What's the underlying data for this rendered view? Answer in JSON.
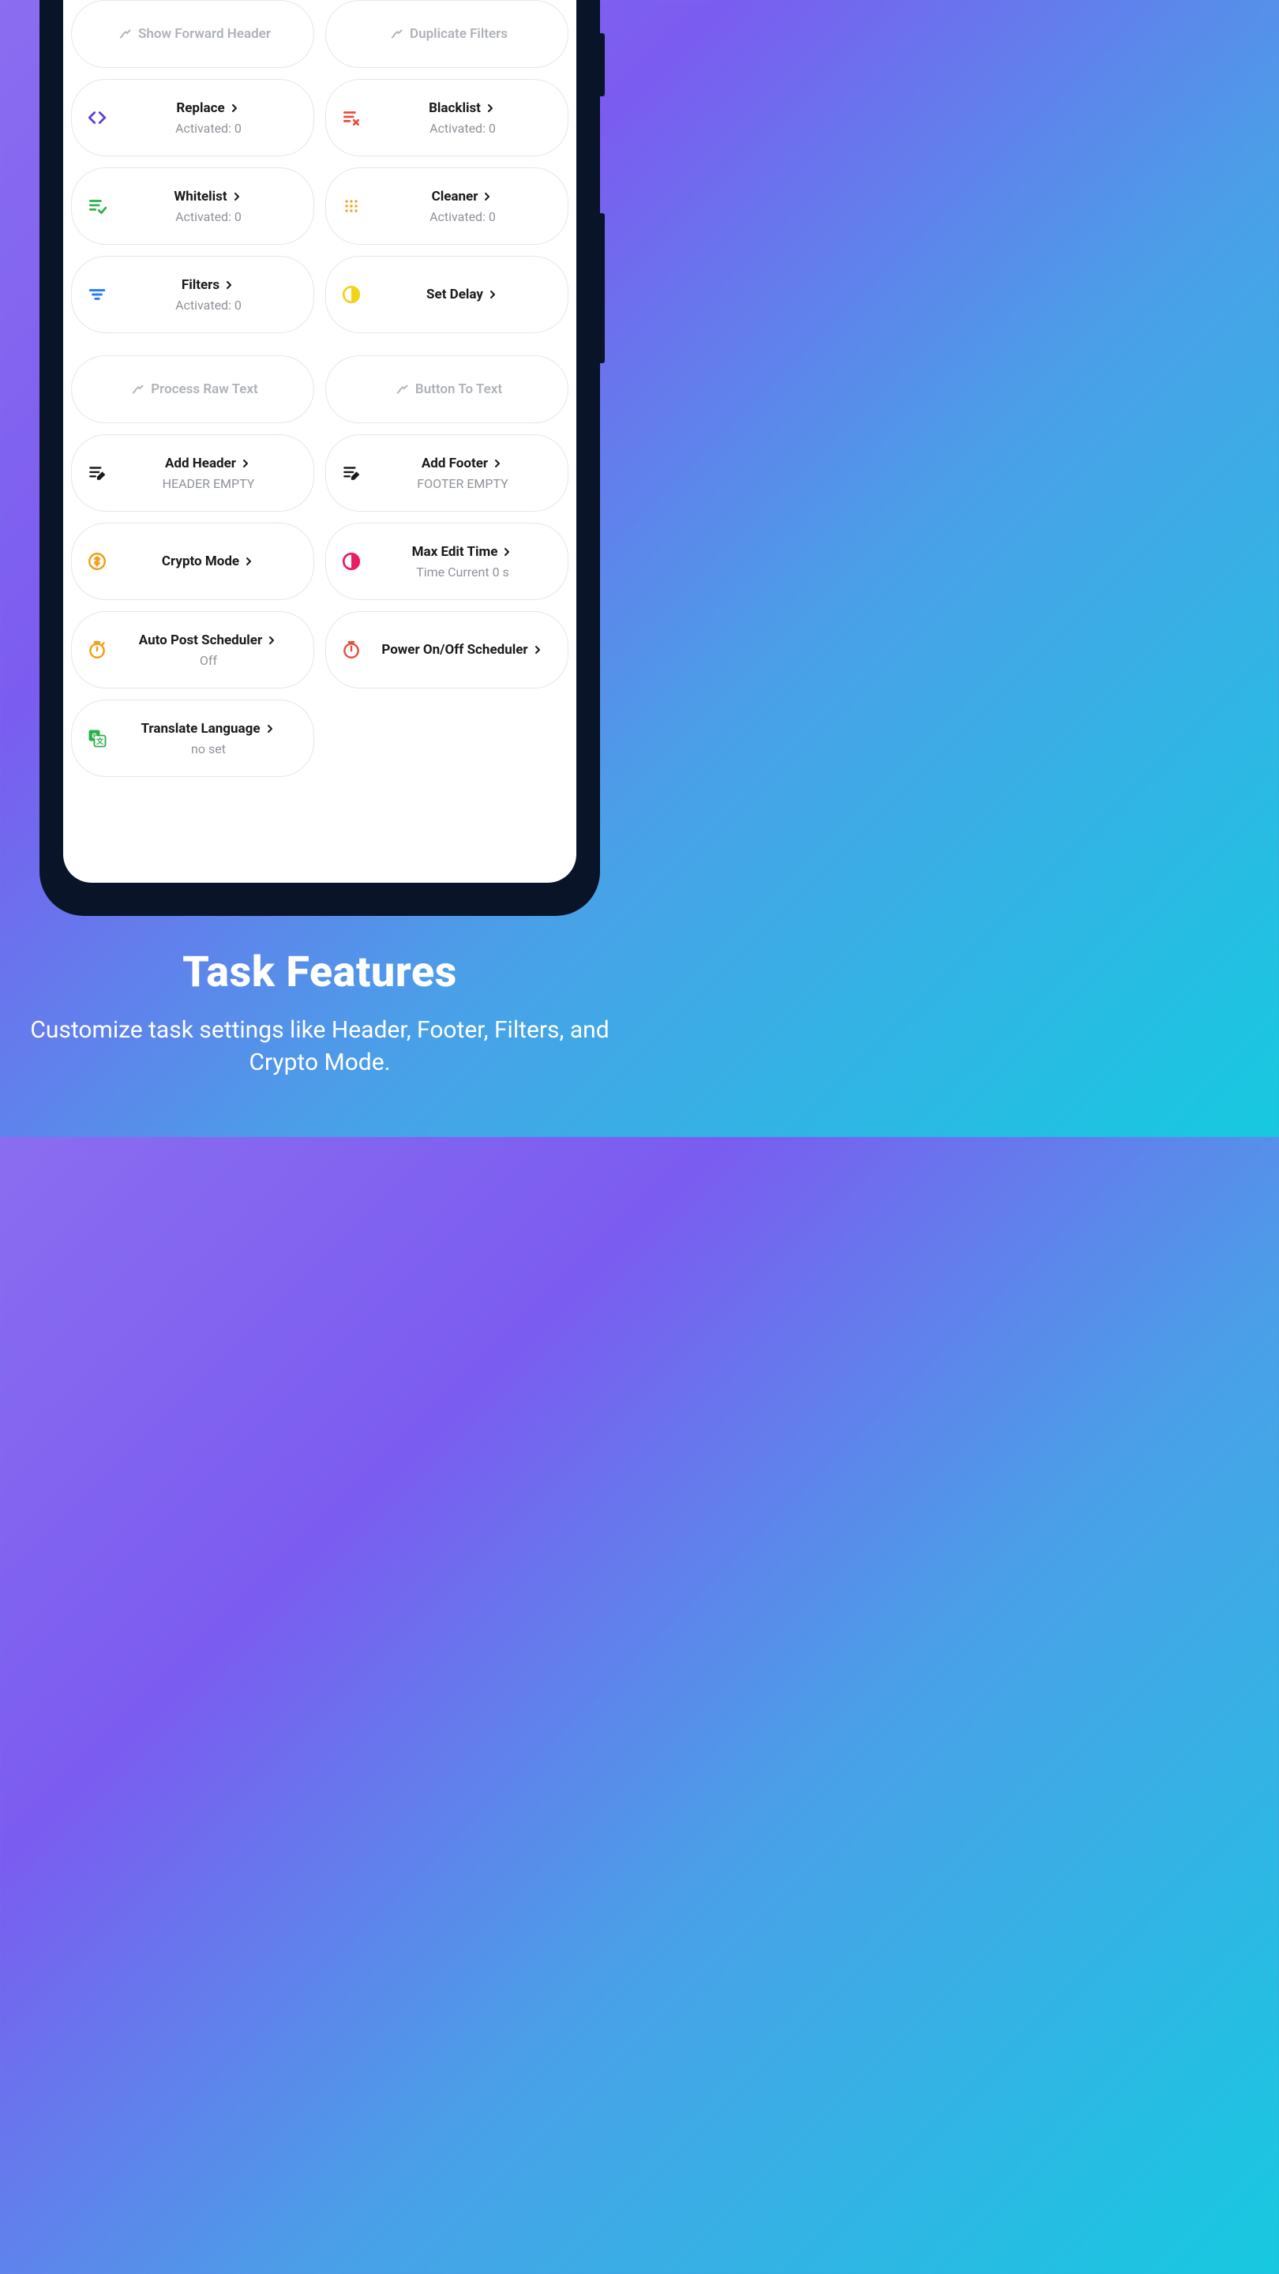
{
  "cards": {
    "show_forward_header": {
      "label": "Show Forward Header"
    },
    "duplicate_filters": {
      "label": "Duplicate Filters"
    },
    "replace": {
      "label": "Replace",
      "sub": "Activated: 0"
    },
    "blacklist": {
      "label": "Blacklist",
      "sub": "Activated: 0"
    },
    "whitelist": {
      "label": "Whitelist",
      "sub": "Activated: 0"
    },
    "cleaner": {
      "label": "Cleaner",
      "sub": "Activated: 0"
    },
    "filters": {
      "label": "Filters",
      "sub": "Activated: 0"
    },
    "set_delay": {
      "label": "Set Delay"
    },
    "process_raw_text": {
      "label": "Process Raw Text"
    },
    "button_to_text": {
      "label": "Button To Text"
    },
    "add_header": {
      "label": "Add Header",
      "sub": "HEADER EMPTY"
    },
    "add_footer": {
      "label": "Add Footer",
      "sub": "FOOTER EMPTY"
    },
    "crypto_mode": {
      "label": "Crypto Mode"
    },
    "max_edit_time": {
      "label": "Max Edit Time",
      "sub": "Time Current 0 s"
    },
    "auto_post_scheduler": {
      "label": "Auto Post Scheduler",
      "sub": "Off"
    },
    "power_scheduler": {
      "label": "Power On/Off Scheduler"
    },
    "translate": {
      "label": "Translate Language",
      "sub": "no set"
    }
  },
  "promo": {
    "title": "Task Features",
    "subtitle": "Customize task settings like Header, Footer, Filters, and Crypto Mode."
  }
}
